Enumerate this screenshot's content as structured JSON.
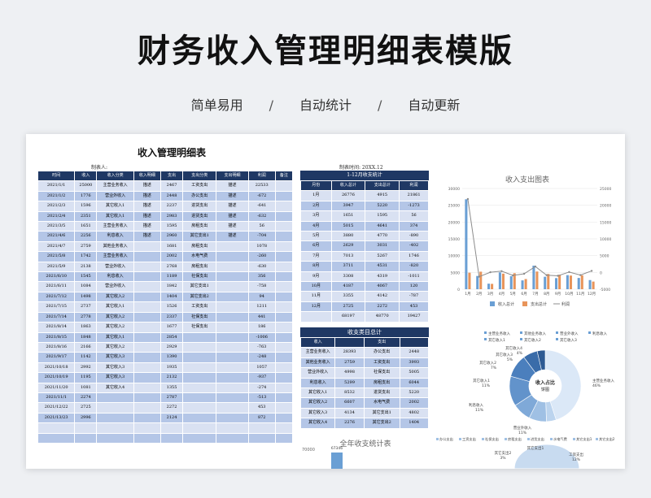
{
  "hero": {
    "title": "财务收入管理明细表模版",
    "tags": [
      "简单易用",
      "自动统计",
      "自动更新"
    ],
    "separator": "/"
  },
  "sheet": {
    "title": "收入管理明细表",
    "maker_label": "制表人:",
    "time_label": "制表时间: 20XX.12"
  },
  "main_table": {
    "headers": [
      "时间",
      "收入",
      "收入分类",
      "收入明细",
      "支出",
      "支出分类",
      "支出明细",
      "利润",
      "备注"
    ],
    "rows": [
      [
        "2021/1/1",
        "25000",
        "主营业务收入",
        "描述",
        "2467",
        "工资支出",
        "描述",
        "22533",
        ""
      ],
      [
        "2021/1/2",
        "1776",
        "营业外收入",
        "描述",
        "2448",
        "办公支出",
        "描述",
        "-672",
        ""
      ],
      [
        "2021/2/3",
        "1596",
        "其它收入1",
        "描述",
        "2237",
        "进货支出",
        "描述",
        "-641",
        ""
      ],
      [
        "2021/2/4",
        "2351",
        "其它收入1",
        "描述",
        "2983",
        "进货支出",
        "描述",
        "-632",
        ""
      ],
      [
        "2021/3/5",
        "1651",
        "主营业务收入",
        "描述",
        "1595",
        "房租支出",
        "描述",
        "56",
        ""
      ],
      [
        "2021/4/6",
        "2256",
        "利息收入",
        "描述",
        "2960",
        "其它支出1",
        "描述",
        "-704",
        ""
      ],
      [
        "2021/4/7",
        "2759",
        "其他业务收入",
        "",
        "1681",
        "房租支出",
        "",
        "1078",
        ""
      ],
      [
        "2021/5/8",
        "1742",
        "主营业务收入",
        "",
        "2002",
        "水电气费",
        "",
        "-260",
        ""
      ],
      [
        "2021/5/9",
        "2138",
        "营业外收入",
        "",
        "2768",
        "房租支出",
        "",
        "-630",
        ""
      ],
      [
        "2021/6/10",
        "1545",
        "利息收入",
        "",
        "1189",
        "社保支出",
        "",
        "356",
        ""
      ],
      [
        "2021/6/11",
        "1084",
        "营业外收入",
        "",
        "1842",
        "其它支出1",
        "",
        "-758",
        ""
      ],
      [
        "2021/7/12",
        "1498",
        "其它收入2",
        "",
        "1404",
        "其它支出2",
        "",
        "94",
        ""
      ],
      [
        "2021/7/15",
        "2737",
        "其它收入1",
        "",
        "1526",
        "工资支出",
        "",
        "1211",
        ""
      ],
      [
        "2021/7/14",
        "2778",
        "其它收入2",
        "",
        "2337",
        "社保支出",
        "",
        "441",
        ""
      ],
      [
        "2021/8/14",
        "1863",
        "其它收入2",
        "",
        "1677",
        "社保支出",
        "",
        "186",
        ""
      ],
      [
        "2021/8/15",
        "1848",
        "其它收入1",
        "",
        "2854",
        "",
        "",
        "-1006",
        ""
      ],
      [
        "2021/8/16",
        "2166",
        "其它收入2",
        "",
        "2929",
        "",
        "",
        "-763",
        ""
      ],
      [
        "2021/9/17",
        "1142",
        "其它收入3",
        "",
        "1390",
        "",
        "",
        "-248",
        ""
      ],
      [
        "2021/10/18",
        "2992",
        "其它收入3",
        "",
        "1935",
        "",
        "",
        "1057",
        ""
      ],
      [
        "2021/10/19",
        "1195",
        "其它收入3",
        "",
        "2132",
        "",
        "",
        "-937",
        ""
      ],
      [
        "2021/11/20",
        "1081",
        "其它收入4",
        "",
        "1355",
        "",
        "",
        "-274",
        ""
      ],
      [
        "2021/11/1",
        "2274",
        "",
        "",
        "2787",
        "",
        "",
        "-513",
        ""
      ],
      [
        "2021/12/22",
        "2725",
        "",
        "",
        "2272",
        "",
        "",
        "453",
        ""
      ],
      [
        "2021/13/23",
        "2996",
        "",
        "",
        "2124",
        "",
        "",
        "872",
        ""
      ],
      [
        "",
        "",
        "",
        "",
        "",
        "",
        "",
        "",
        ""
      ],
      [
        "",
        "",
        "",
        "",
        "",
        "",
        "",
        "",
        ""
      ]
    ]
  },
  "monthly": {
    "title": "1-12月收支统计",
    "headers": [
      "月份",
      "收入总计",
      "支出总计",
      "利润"
    ],
    "rows": [
      [
        "1月",
        "26776",
        "4915",
        "21861"
      ],
      [
        "2月",
        "3947",
        "5220",
        "-1273"
      ],
      [
        "3月",
        "1651",
        "1595",
        "56"
      ],
      [
        "4月",
        "5015",
        "4641",
        "374"
      ],
      [
        "5月",
        "3880",
        "4770",
        "-890"
      ],
      [
        "6月",
        "2629",
        "3031",
        "-402"
      ],
      [
        "7月",
        "7013",
        "5267",
        "1746"
      ],
      [
        "8月",
        "3711",
        "4531",
        "-820"
      ],
      [
        "9月",
        "3308",
        "4319",
        "-1011"
      ],
      [
        "10月",
        "4187",
        "4067",
        "120"
      ],
      [
        "11月",
        "3355",
        "4142",
        "-787"
      ],
      [
        "12月",
        "2725",
        "2272",
        "453"
      ],
      [
        "",
        "68197",
        "48770",
        "19427"
      ]
    ]
  },
  "categories": {
    "title": "收支类目总计",
    "headers": [
      "收入",
      "",
      "支出",
      ""
    ],
    "rows": [
      [
        "主营业务收入",
        "28393",
        "办公支出",
        "2448"
      ],
      [
        "其他业务收入",
        "2759",
        "工资支出",
        "3993"
      ],
      [
        "营业外收入",
        "4998",
        "社保支出",
        "5005"
      ],
      [
        "利息收入",
        "5299",
        "房租支出",
        "6044"
      ],
      [
        "其它收入1",
        "8532",
        "进货支出",
        "5220"
      ],
      [
        "其它收入2",
        "6607",
        "水电气费",
        "2002"
      ],
      [
        "其它收入3",
        "4134",
        "其它支出1",
        "4802"
      ],
      [
        "其它收入4",
        "2276",
        "其它支出2",
        "1404"
      ]
    ]
  },
  "chart_data": [
    {
      "type": "bar",
      "title": "收入支出图表",
      "categories": [
        "1月",
        "2月",
        "3月",
        "4月",
        "5月",
        "6月",
        "7月",
        "8月",
        "9月",
        "10月",
        "11月",
        "12月"
      ],
      "series": [
        {
          "name": "收入总计",
          "values": [
            26776,
            3947,
            1651,
            5015,
            3880,
            2629,
            7013,
            3711,
            3308,
            4187,
            3355,
            2725
          ],
          "color": "#6a9fd4"
        },
        {
          "name": "支出总计",
          "values": [
            4915,
            5220,
            1595,
            4641,
            4770,
            3031,
            5267,
            4531,
            4319,
            4067,
            4142,
            2272
          ],
          "color": "#e8945a"
        },
        {
          "name": "利润",
          "values": [
            21861,
            -1273,
            56,
            374,
            -890,
            -402,
            1746,
            -820,
            -1011,
            120,
            -787,
            453
          ],
          "color": "#8c8c8c",
          "type": "line",
          "axis": "right"
        }
      ],
      "ylim": [
        0,
        30000
      ],
      "yticks": [
        "30000",
        "25000",
        "20000",
        "15000",
        "10000",
        "5000",
        "0"
      ],
      "y2lim": [
        -5000,
        25000
      ],
      "y2ticks": [
        "25000",
        "20000",
        "15000",
        "10000",
        "5000",
        "0",
        "-5000"
      ],
      "legend": "bottom"
    },
    {
      "type": "pie",
      "center_label": [
        "收入占比",
        "饼图"
      ],
      "labels": [
        "主营业务收入",
        "其他业务收入",
        "营业外收入",
        "利息收入",
        "其它收入1",
        "其它收入2",
        "其它收入3",
        "其它收入4"
      ],
      "values": [
        28393,
        2759,
        4998,
        5299,
        8532,
        6607,
        4134,
        2276
      ],
      "callouts": [
        {
          "name": "主营业务收入",
          "pct": "46%"
        },
        {
          "name": "营业外收入",
          "pct": "11%"
        },
        {
          "name": "利息收入",
          "pct": "11%"
        },
        {
          "name": "其它收入1",
          "pct": "11%"
        },
        {
          "name": "其它收入2",
          "pct": "7%"
        },
        {
          "name": "其它收入3",
          "pct": "5%"
        },
        {
          "name": "其它收入4",
          "pct": "4%"
        }
      ],
      "legend": "top"
    },
    {
      "type": "pie",
      "legend_items": [
        "办公支出",
        "工资支出",
        "社保支出",
        "房租支出",
        "进货支出",
        "水电气费",
        "其它支出1",
        "其它支出2"
      ],
      "callouts": [
        {
          "name": "其它支出2",
          "pct": "3%"
        },
        {
          "name": "工资支出",
          "pct": "12%"
        },
        {
          "name": "其它支出1",
          "pct": ""
        }
      ]
    },
    {
      "type": "bar",
      "title": "全年收支统计表",
      "categories": [
        "收入"
      ],
      "values": [
        67346
      ],
      "yticks": [
        "70000"
      ],
      "value_label": "67346"
    }
  ]
}
